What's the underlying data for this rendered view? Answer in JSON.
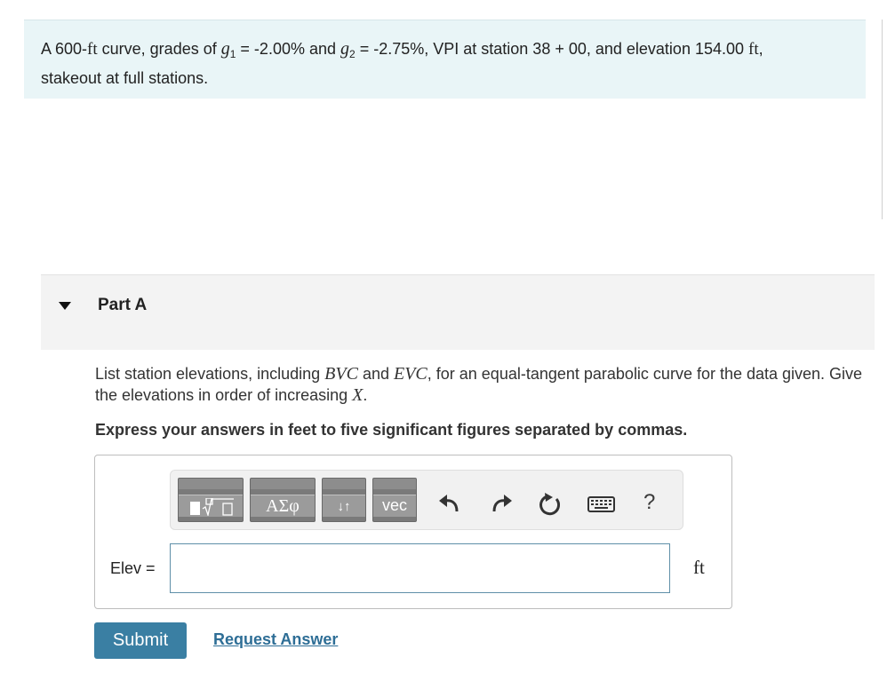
{
  "problem": {
    "prefix": "A 600-",
    "unit_ft": "ft",
    "mid1": " curve, grades of ",
    "g": "g",
    "sub1": "1",
    "val1": " = -2.00% and ",
    "sub2": "2",
    "val2": " = -2.75%, VPI at station 38 + 00, and elevation 154.00 ",
    "unit_ft2": "ft",
    "suffix": ",",
    "line2": "stakeout at full stations."
  },
  "part": {
    "title": "Part A"
  },
  "question": {
    "t1": "List station elevations, including ",
    "bvc": "BVC",
    "t2": " and ",
    "evc": "EVC",
    "t3": ", for an equal-tangent parabolic curve for the data given. Give the elevations in order of increasing ",
    "x": "X",
    "t4": ".",
    "instruction": "Express your answers in feet to five significant figures separated by commas."
  },
  "toolbar": {
    "greek_label": "ΑΣφ",
    "arrows_label": "↓↑",
    "vec_label": "vec",
    "help_label": "?"
  },
  "answer": {
    "label": "Elev =",
    "value": "",
    "unit": "ft"
  },
  "actions": {
    "submit": "Submit",
    "request": "Request Answer"
  }
}
